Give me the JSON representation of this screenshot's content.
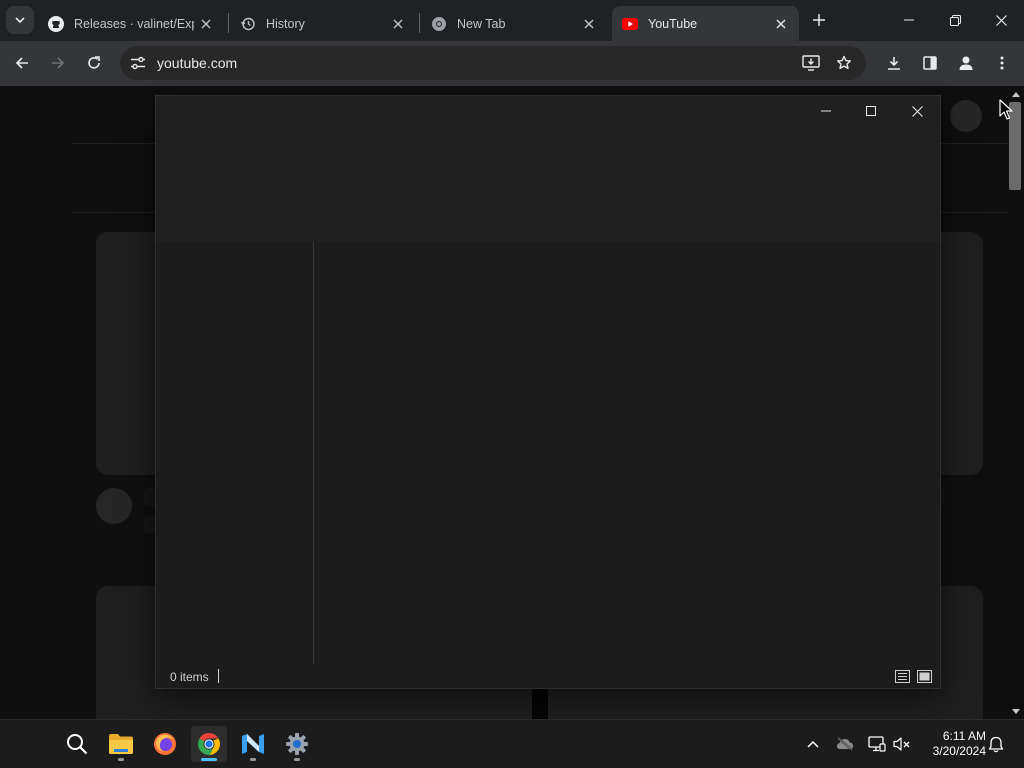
{
  "browser": {
    "tabs": [
      {
        "title": "Releases · valinet/ExplorerPatcher",
        "icon": "github-icon",
        "active": false
      },
      {
        "title": "History",
        "icon": "history-icon",
        "active": false
      },
      {
        "title": "New Tab",
        "icon": "chrome-icon",
        "active": false
      },
      {
        "title": "YouTube",
        "icon": "youtube-icon",
        "active": true
      }
    ],
    "omnibox": {
      "url": "youtube.com"
    }
  },
  "explorer_window": {
    "status_count": "0 items"
  },
  "taskbar": {
    "apps": [
      {
        "name": "search-icon"
      },
      {
        "name": "file-explorer-icon"
      },
      {
        "name": "firefox-icon"
      },
      {
        "name": "chrome-icon",
        "active": true
      },
      {
        "name": "visual-studio-icon"
      },
      {
        "name": "settings-icon"
      }
    ],
    "clock": {
      "time": "6:11 AM",
      "date": "3/20/2024"
    }
  },
  "colors": {
    "youtube_red": "#ff0000",
    "accent": "#4cc2ff",
    "chrome_frame": "#202124",
    "toolbar": "#35363a"
  }
}
